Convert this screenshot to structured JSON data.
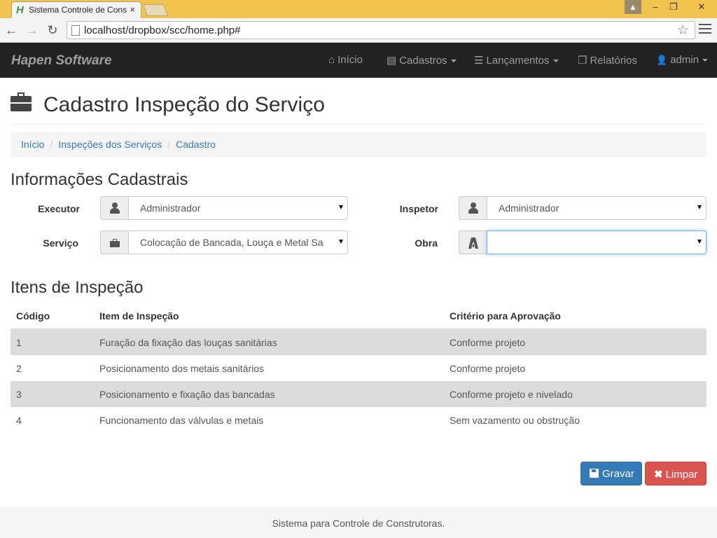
{
  "browser": {
    "tab_title": "Sistema Controle de Cons",
    "tab_close": "×",
    "url": "localhost/dropbox/scc/home.php#",
    "star": "☆",
    "minimize": "–",
    "restore": "❐",
    "close": "✕",
    "back": "←",
    "forward": "→",
    "reload": "↻",
    "favicon": "H"
  },
  "navbar": {
    "brand": "Hapen Software",
    "items": [
      {
        "label": "Início",
        "icon": "home-icon",
        "glyph": "⌂"
      },
      {
        "label": "Cadastros",
        "icon": "list-alt-icon",
        "glyph": "▤"
      },
      {
        "label": "Lançamentos",
        "icon": "th-list-icon",
        "glyph": "☰"
      },
      {
        "label": "Relatórios",
        "icon": "copy-icon",
        "glyph": "❐"
      },
      {
        "label": "admin",
        "icon": "user-icon",
        "glyph": "👤"
      }
    ]
  },
  "page": {
    "title": "Cadastro Inspeção do Serviço",
    "icon": "briefcase-icon"
  },
  "breadcrumb": [
    {
      "label": "Início"
    },
    {
      "label": "Inspeções dos Serviços"
    },
    {
      "label": "Cadastro"
    }
  ],
  "breadcrumb_sep": "/",
  "form": {
    "section_title": "Informações Cadastrais",
    "executor": {
      "label": "Executor",
      "value": "Administrador",
      "icon": "user-icon"
    },
    "inspetor": {
      "label": "Inspetor",
      "value": "Administrador",
      "icon": "user-icon"
    },
    "servico": {
      "label": "Serviço",
      "value": "Colocação de Bancada, Louça e Metal Sa",
      "icon": "briefcase-icon"
    },
    "obra": {
      "label": "Obra",
      "value": "",
      "icon": "road-icon"
    }
  },
  "items": {
    "section_title": "Itens de Inspeção",
    "columns": [
      "Código",
      "Item de Inspeção",
      "Critério para Aprovação"
    ],
    "rows": [
      [
        "1",
        "Furação da fixação das louças sanitárias",
        "Conforme projeto"
      ],
      [
        "2",
        "Posicionamento dos metais sanitários",
        "Conforme projeto"
      ],
      [
        "3",
        "Posicionamento e fixação das bancadas",
        "Conforme projeto e nivelado"
      ],
      [
        "4",
        "Funcionamento das válvulas e metais",
        "Sem vazamento ou obstrução"
      ]
    ]
  },
  "buttons": {
    "save": "Gravar",
    "clear": "Limpar",
    "clear_glyph": "✖"
  },
  "footer": {
    "text": "Sistema para Controle de Construtoras."
  },
  "colors": {
    "navbar_bg": "#222222",
    "primary": "#337ab7",
    "danger": "#d9534f",
    "link": "#337ab7"
  }
}
